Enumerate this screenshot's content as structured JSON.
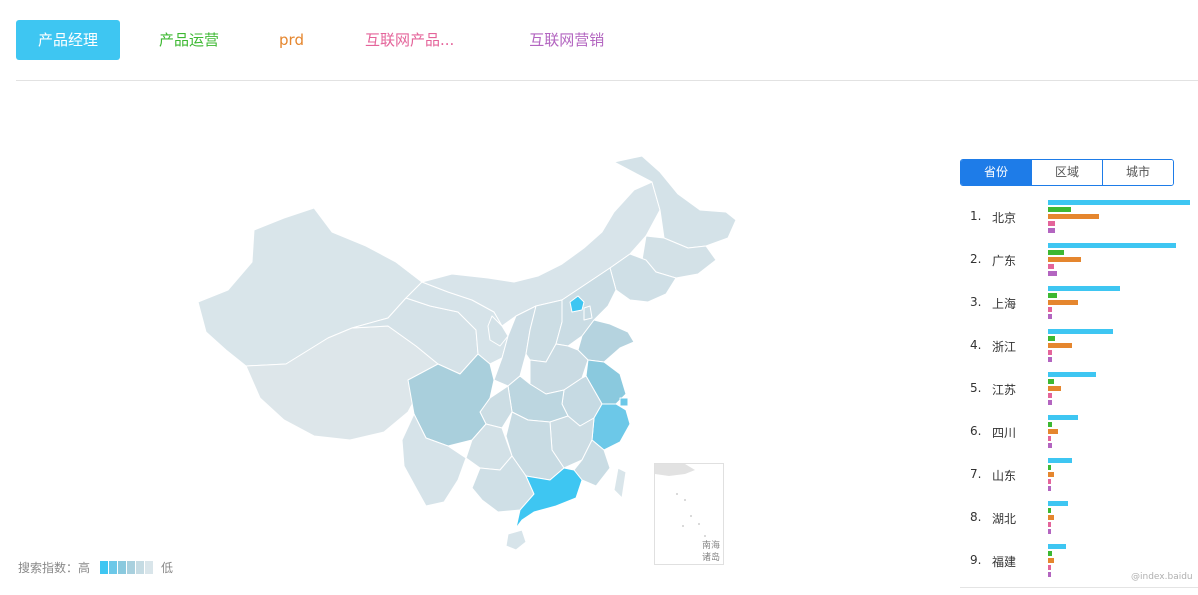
{
  "keywords": [
    {
      "label": "产品经理",
      "color": "#3ec6f2",
      "active": true
    },
    {
      "label": "产品运营",
      "color": "#3db832"
    },
    {
      "label": "prd",
      "color": "#e5862e"
    },
    {
      "label": "互联网产品...",
      "color": "#e4649a"
    },
    {
      "label": "互联网营销",
      "color": "#b365c0"
    }
  ],
  "region_tabs": [
    {
      "label": "省份",
      "active": true
    },
    {
      "label": "区域"
    },
    {
      "label": "城市"
    }
  ],
  "ranking": [
    {
      "rank": "1.",
      "name": "北京",
      "values": [
        1.0,
        0.16,
        0.36,
        0.05,
        0.05
      ]
    },
    {
      "rank": "2.",
      "name": "广东",
      "values": [
        0.9,
        0.11,
        0.23,
        0.04,
        0.06
      ]
    },
    {
      "rank": "3.",
      "name": "上海",
      "values": [
        0.51,
        0.06,
        0.21,
        0.03,
        0.03
      ]
    },
    {
      "rank": "4.",
      "name": "浙江",
      "values": [
        0.46,
        0.05,
        0.17,
        0.03,
        0.03
      ]
    },
    {
      "rank": "5.",
      "name": "江苏",
      "values": [
        0.34,
        0.04,
        0.09,
        0.03,
        0.03
      ]
    },
    {
      "rank": "6.",
      "name": "四川",
      "values": [
        0.21,
        0.03,
        0.07,
        0.02,
        0.03
      ]
    },
    {
      "rank": "7.",
      "name": "山东",
      "values": [
        0.17,
        0.02,
        0.04,
        0.02,
        0.02
      ]
    },
    {
      "rank": "8.",
      "name": "湖北",
      "values": [
        0.14,
        0.02,
        0.04,
        0.02,
        0.02
      ]
    },
    {
      "rank": "9.",
      "name": "福建",
      "values": [
        0.13,
        0.03,
        0.04,
        0.02,
        0.02
      ]
    }
  ],
  "legend": {
    "label": "搜索指数：高",
    "low": "低",
    "colors": [
      "#3ec6f2",
      "#6cc8e8",
      "#8ac9de",
      "#a9d0de",
      "#c5dbe3",
      "#d9e5ea"
    ]
  },
  "map": {
    "inset_label": "南海诸岛",
    "base_color": "#d9e5ea",
    "highlights": [
      {
        "name": "北京",
        "color": "#3ec6f2"
      },
      {
        "name": "广东",
        "color": "#3ec6f2"
      },
      {
        "name": "浙江",
        "color": "#6cc8e8"
      },
      {
        "name": "上海",
        "color": "#6cc8e8"
      },
      {
        "name": "江苏",
        "color": "#8ac9de"
      },
      {
        "name": "四川",
        "color": "#a9cfdc"
      }
    ]
  },
  "watermark": "@index.baidu"
}
